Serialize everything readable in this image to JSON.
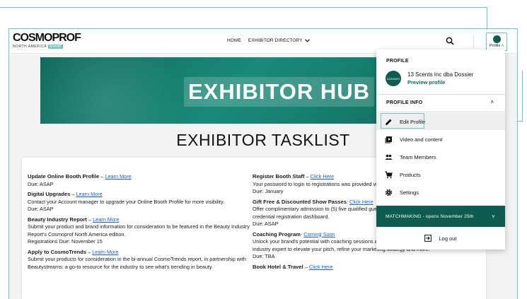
{
  "header": {
    "logo_main": "COSMOPROF",
    "logo_sub": "NORTH AMERICA",
    "logo_tag": "MIAMI",
    "nav": {
      "home": "HOME",
      "directory": "EXHIBITOR DIRECTORY"
    },
    "profile_label": "Profile"
  },
  "hero": {
    "title": "EXHIBITOR HUB"
  },
  "tasklist": {
    "title": "EXHIBITOR TASKLIST",
    "left": [
      {
        "title": "Update Online Booth Profile",
        "sep": " – ",
        "link": "Learn More",
        "lines": [
          "Due: ASAP"
        ]
      },
      {
        "title": "Digital Upgrades",
        "sep": " – ",
        "link": "Learn More",
        "lines": [
          "Contact your Account manager to upgrade your Online Booth Profile for more visibility.",
          "Due: ASAP"
        ]
      },
      {
        "title": "Beauty Industry Report",
        "sep": " – ",
        "link": "Learn More",
        "lines": [
          "Submit your product and brand information for consideration to be featured in the Beauty Industry Report's Cosmoprof North America edition.",
          "Registrations Due: November 15"
        ]
      },
      {
        "title": "Apply to CosmoTrends",
        "sep": " – ",
        "link": "Learn More",
        "lines": [
          "Submit your products for consideration in the bi-annual CosmoTrends report, in partnership with Beautystreams: a go-to resource for the industry to see what's trending in beauty."
        ]
      }
    ],
    "right": [
      {
        "title": "Register Booth Staff",
        "sep": " – ",
        "link": "Click Here",
        "lines": [
          "Your password to login to registrations was provided via er",
          "Due: January"
        ]
      },
      {
        "title": "Gift Free & Discounted Show Passes",
        "sep": ": ",
        "link": "Click Here",
        "lines": [
          "Offer complimentary admission to (5) five qualified guests",
          "credential registration dashboard.",
          "Due: ASAP"
        ]
      },
      {
        "title": "Coaching Program",
        "sep": "- ",
        "link": "Coming Soon",
        "lines": [
          "Unlock your brand's potential with coaching sessions at the show. Apply to be connected with an industry expert to elevate your pitch, refine your marketing strategy and more.",
          "Due: TBA"
        ]
      },
      {
        "title": "Book Hotel & Travel",
        "sep": " – ",
        "link": "Click Here",
        "lines": []
      }
    ]
  },
  "dropdown": {
    "profile_heading": "PROFILE",
    "company_name": "13 Scents Inc dba Dossier",
    "preview_label": "Preview profile",
    "avatar_text": "DOSSIER",
    "profile_info_heading": "PROFILE INFO",
    "items": [
      {
        "label": "Edit Profile",
        "icon": "pencil-icon"
      },
      {
        "label": "Video and content",
        "icon": "video-icon"
      },
      {
        "label": "Team Members",
        "icon": "people-icon"
      },
      {
        "label": "Products",
        "icon": "cart-icon"
      },
      {
        "label": "Settings",
        "icon": "gear-icon"
      }
    ],
    "matchmaking": "MATCHMAKING - opens November 25th",
    "logout": "Log out"
  },
  "colors": {
    "brand_teal": "#0d5c50",
    "annotation": "#6cc6c4",
    "link": "#1a5fd0"
  }
}
